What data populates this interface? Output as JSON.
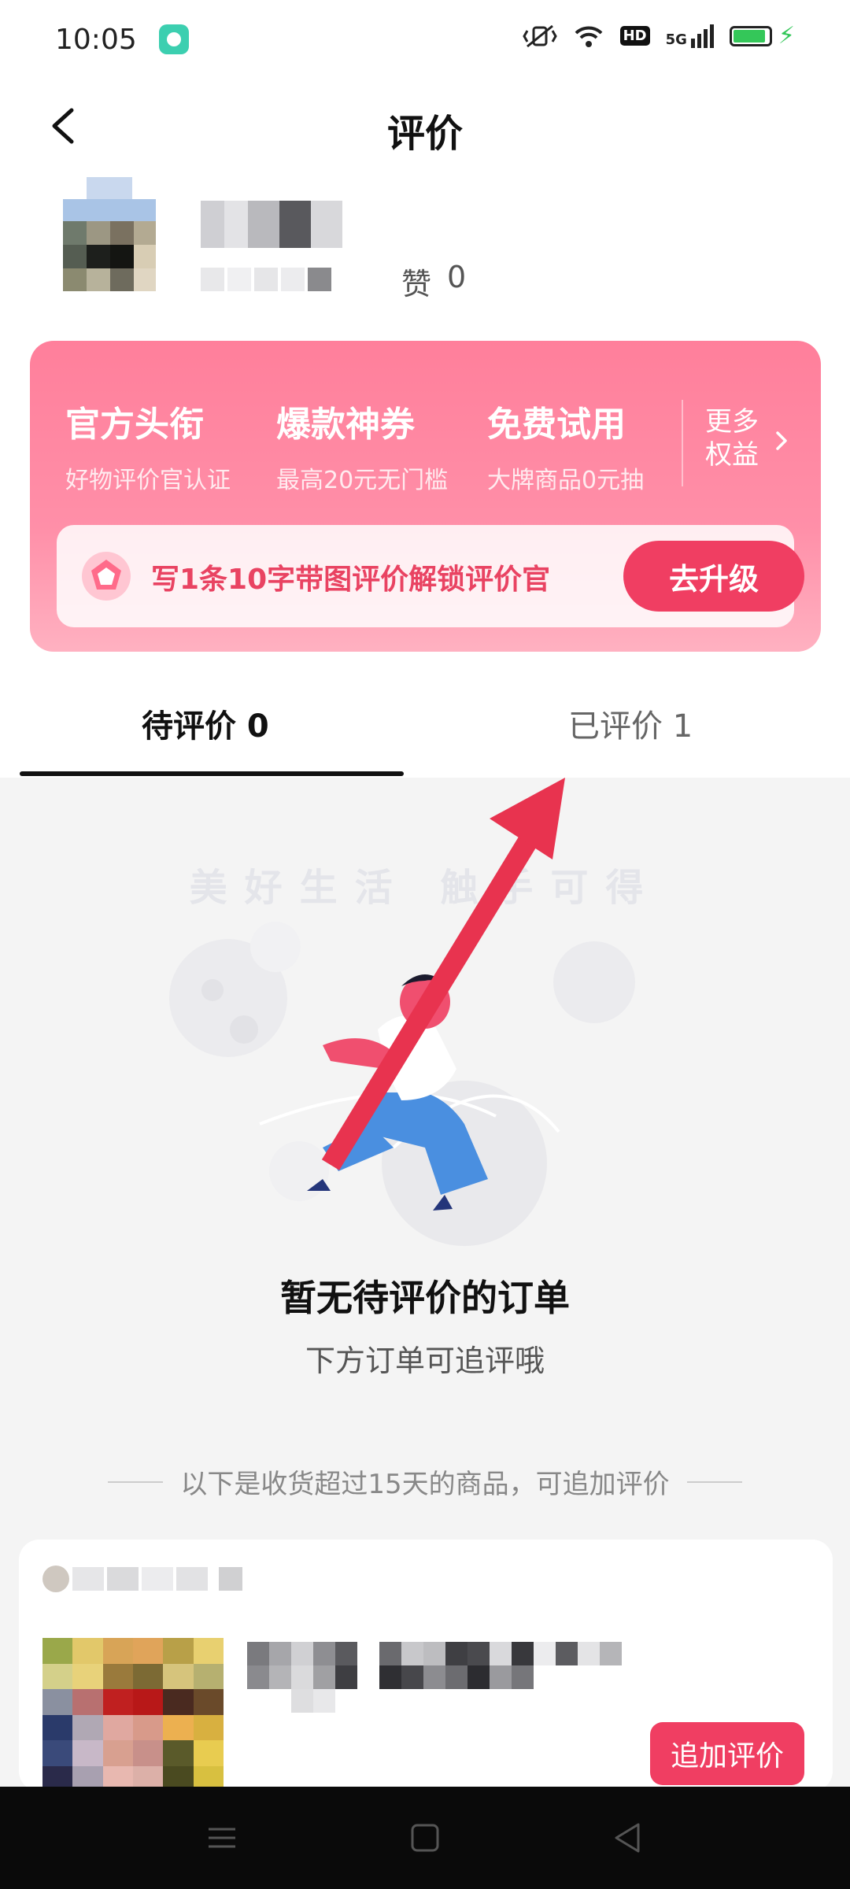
{
  "status_bar": {
    "time": "10:05",
    "network_label": "5G",
    "hd_label": "HD",
    "battery_level": 0.9,
    "icons": [
      "vibrate-off-icon",
      "wifi-icon",
      "hd-icon",
      "signal-icon",
      "battery-icon",
      "charging-icon"
    ]
  },
  "header": {
    "title": "评价",
    "back_icon": "chevron-left-icon"
  },
  "profile": {
    "likes_label": "赞",
    "likes_count": "0"
  },
  "promo": {
    "items": [
      {
        "title": "官方头衔",
        "subtitle": "好物评价官认证"
      },
      {
        "title": "爆款神券",
        "subtitle": "最高20元无门槛"
      },
      {
        "title": "免费试用",
        "subtitle": "大牌商品0元抽"
      }
    ],
    "more_label": "更多权益",
    "unlock_text": "写1条10字带图评价解锁评价官",
    "upgrade_label": "去升级"
  },
  "tabs": [
    {
      "label": "待评价 0",
      "active": true
    },
    {
      "label": "已评价 1",
      "active": false
    }
  ],
  "empty_state": {
    "slogan": "美好生活 触手可得",
    "title": "暂无待评价的订单",
    "subtitle": "下方订单可追评哦"
  },
  "section_hint": "以下是收货超过15天的商品，可追加评价",
  "order": {
    "follow_up_label": "追加评价"
  },
  "colors": {
    "accent": "#f03e62",
    "promo_gradient_top": "#ff7f9b",
    "arrow": "#e8334f"
  }
}
